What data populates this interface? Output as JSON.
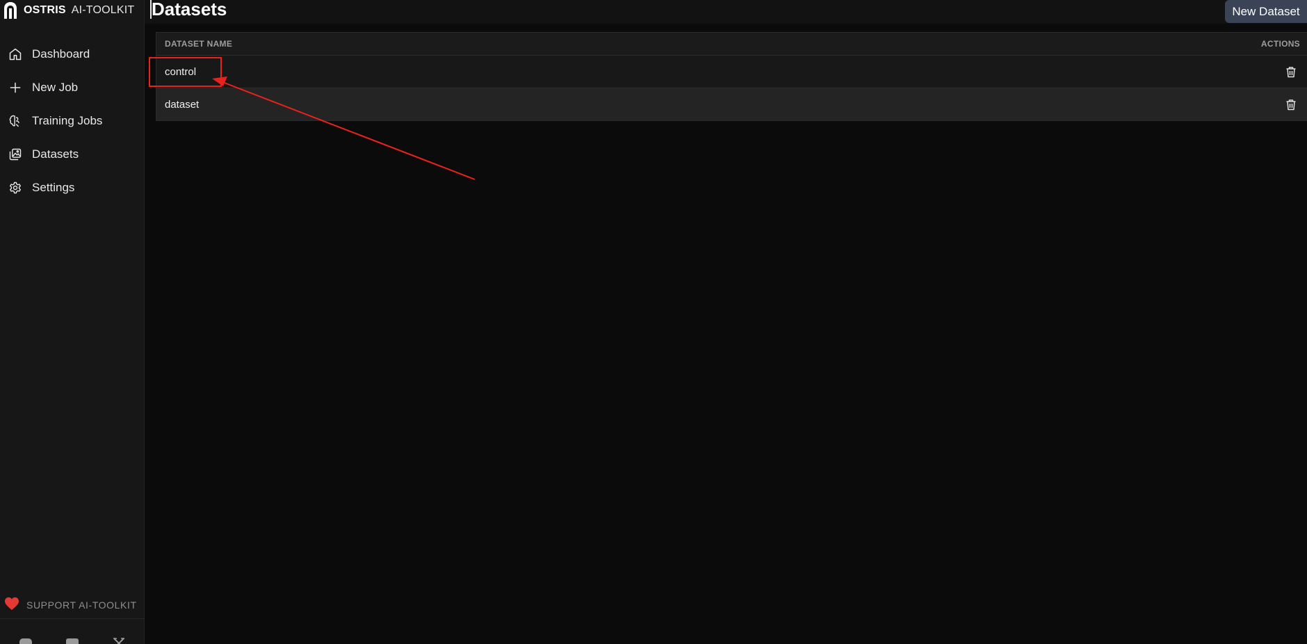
{
  "brand": {
    "strong": "OSTRIS",
    "light": "AI-TOOLKIT"
  },
  "sidebar": {
    "items": [
      {
        "label": "Dashboard",
        "icon": "home-icon"
      },
      {
        "label": "New Job",
        "icon": "plus-icon"
      },
      {
        "label": "Training Jobs",
        "icon": "brain-icon"
      },
      {
        "label": "Datasets",
        "icon": "images-icon"
      },
      {
        "label": "Settings",
        "icon": "gear-icon"
      }
    ],
    "support_label": "SUPPORT AI-TOOLKIT",
    "social_icons": [
      "discord-icon",
      "youtube-icon",
      "x-icon"
    ]
  },
  "header": {
    "title": "Datasets",
    "new_dataset_label": "New Dataset"
  },
  "table": {
    "columns": {
      "name": "DATASET NAME",
      "actions": "ACTIONS"
    },
    "rows": [
      {
        "name": "control"
      },
      {
        "name": "dataset"
      }
    ]
  },
  "colors": {
    "accent_button": "#3a4456",
    "annotation": "#e8221c",
    "heart": "#e53935"
  }
}
